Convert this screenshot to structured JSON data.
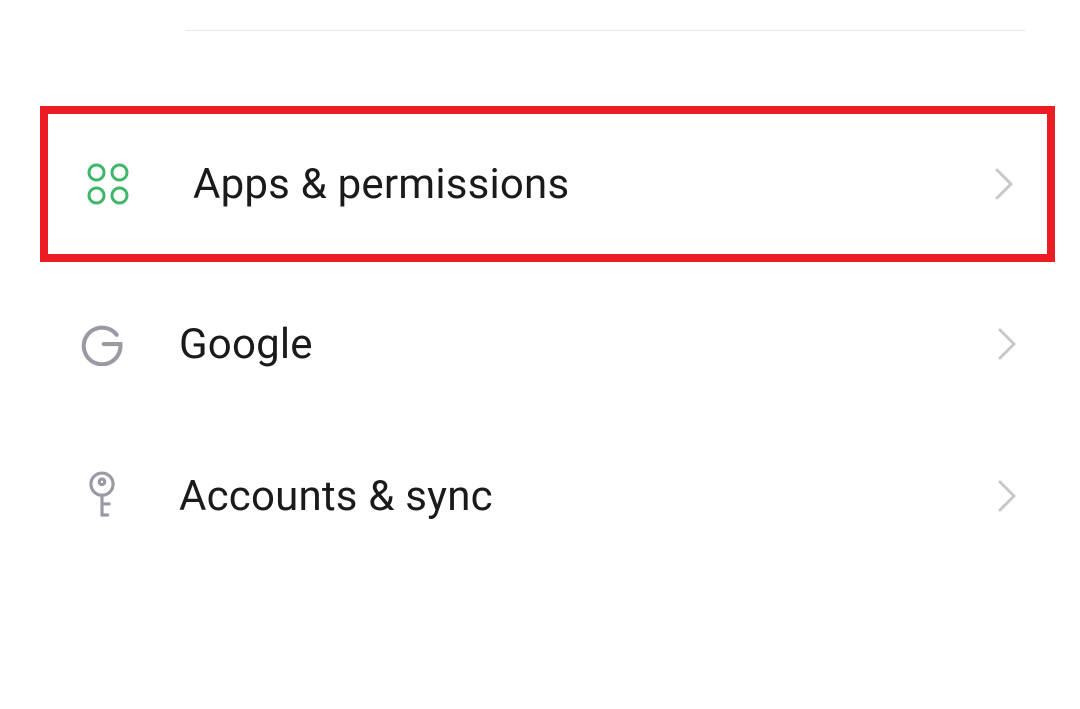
{
  "settings": {
    "items": [
      {
        "icon": "apps-grid-icon",
        "label": "Apps & permissions",
        "highlighted": true
      },
      {
        "icon": "google-g-icon",
        "label": "Google",
        "highlighted": false
      },
      {
        "icon": "key-icon",
        "label": "Accounts & sync",
        "highlighted": false
      }
    ]
  },
  "colors": {
    "highlight": "#ec1c24",
    "iconGreen": "#3fb76a",
    "iconGray": "#9a9aa6",
    "chevronGray": "#c7c7cd",
    "text": "#1a1a1a"
  }
}
